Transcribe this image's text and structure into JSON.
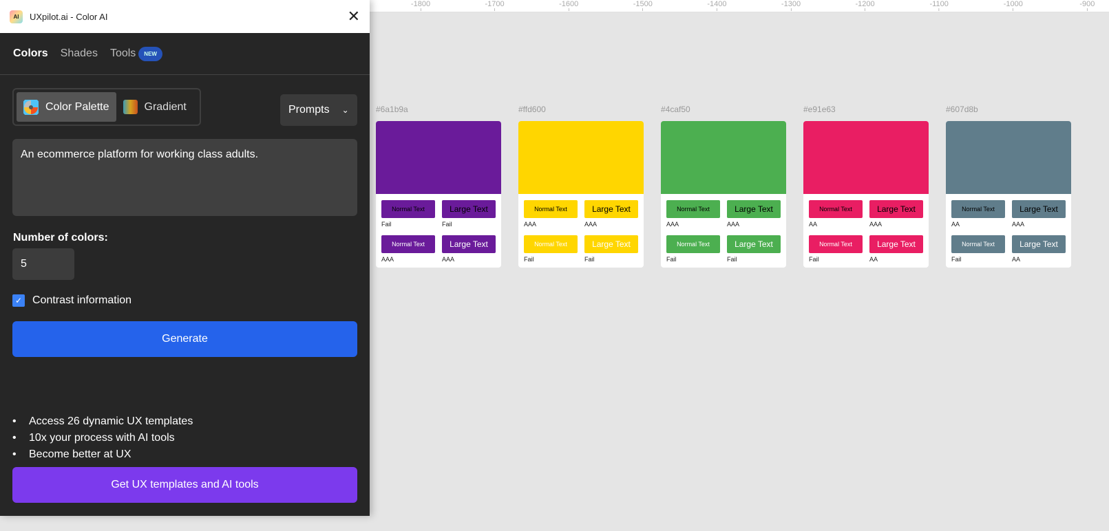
{
  "ruler": {
    "ticks": [
      "-1800",
      "-1700",
      "-1600",
      "-1500",
      "-1400",
      "-1300",
      "-1200",
      "-1100",
      "-1000",
      "-900"
    ]
  },
  "panel": {
    "title": "UXpilot.ai - Color AI",
    "logo_text": "AI",
    "tabs": [
      {
        "label": "Colors"
      },
      {
        "label": "Shades"
      },
      {
        "label": "Tools"
      }
    ],
    "new_badge": "NEW",
    "modes": [
      {
        "label": "Color Palette"
      },
      {
        "label": "Gradient"
      }
    ],
    "prompts_label": "Prompts",
    "prompt_text": "An ecommerce platform for working class adults.",
    "num_colors_label": "Number of colors:",
    "num_colors": "5",
    "contrast_label": "Contrast information",
    "contrast_checked": true,
    "generate_label": "Generate",
    "bullets": [
      "Access 26 dynamic UX templates",
      "10x your process with AI tools",
      "Become better at UX"
    ],
    "cta_label": "Get UX templates and AI tools"
  },
  "chip_labels": {
    "normal": "Normal Text",
    "large": "Large Text"
  },
  "palette": [
    {
      "hex": "#6a1b9a",
      "results": [
        "Fail",
        "Fail",
        "AAA",
        "AAA"
      ]
    },
    {
      "hex": "#ffd600",
      "results": [
        "AAA",
        "AAA",
        "Fail",
        "Fail"
      ]
    },
    {
      "hex": "#4caf50",
      "results": [
        "AAA",
        "AAA",
        "Fail",
        "Fail"
      ]
    },
    {
      "hex": "#e91e63",
      "results": [
        "AA",
        "AAA",
        "Fail",
        "AA"
      ]
    },
    {
      "hex": "#607d8b",
      "results": [
        "AA",
        "AAA",
        "Fail",
        "AA"
      ]
    }
  ]
}
